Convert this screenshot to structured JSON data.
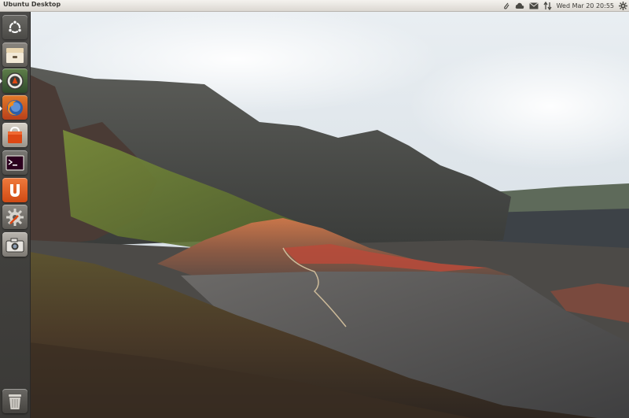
{
  "panel": {
    "title": "Ubuntu Desktop",
    "datetime": "Wed Mar 20  20:55"
  },
  "indicators": [
    {
      "icon": "paperclip-icon"
    },
    {
      "icon": "cloud-icon"
    },
    {
      "icon": "mail-icon"
    },
    {
      "icon": "network-arrows-icon"
    },
    {
      "icon": "gear-icon"
    }
  ],
  "launcher": {
    "items": [
      {
        "name": "dash-home",
        "icon": "ubuntu-logo-icon"
      },
      {
        "name": "files",
        "icon": "file-cabinet-icon"
      },
      {
        "name": "update-manager",
        "icon": "update-manager-icon"
      },
      {
        "name": "firefox",
        "icon": "firefox-icon"
      },
      {
        "name": "software-center",
        "icon": "shopping-bag-icon"
      },
      {
        "name": "terminal",
        "icon": "terminal-icon"
      },
      {
        "name": "ubuntu-one",
        "icon": "ubuntu-one-icon"
      },
      {
        "name": "system-settings",
        "icon": "settings-icon"
      },
      {
        "name": "screenshot",
        "icon": "camera-icon"
      },
      {
        "name": "trash",
        "icon": "trash-icon"
      }
    ]
  },
  "colors": {
    "launcher_bg": "#3f3e3b",
    "panel_bg": "#e8e5e0",
    "accent": "#dd4814"
  }
}
